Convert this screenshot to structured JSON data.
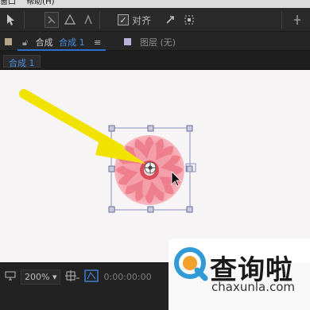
{
  "menubar": {
    "items": [
      "窗口",
      "帮助(H)"
    ]
  },
  "toolbar": {
    "align_label": "对齐"
  },
  "panel": {
    "composition_label": "合成",
    "composition_name": "合成 1",
    "layer_label": "图层 (无)"
  },
  "tabs": {
    "active": "合成 1"
  },
  "viewer": {
    "zoom": "200%",
    "timecode": "0:00:00:00"
  },
  "watermark": {
    "brand": "查询啦",
    "url": "chaxunla.com"
  },
  "colors": {
    "accent": "#2a6fce",
    "arrow": "#f2e200",
    "flower": "#f07a8a",
    "bounding_box": "#8a8fc4"
  }
}
